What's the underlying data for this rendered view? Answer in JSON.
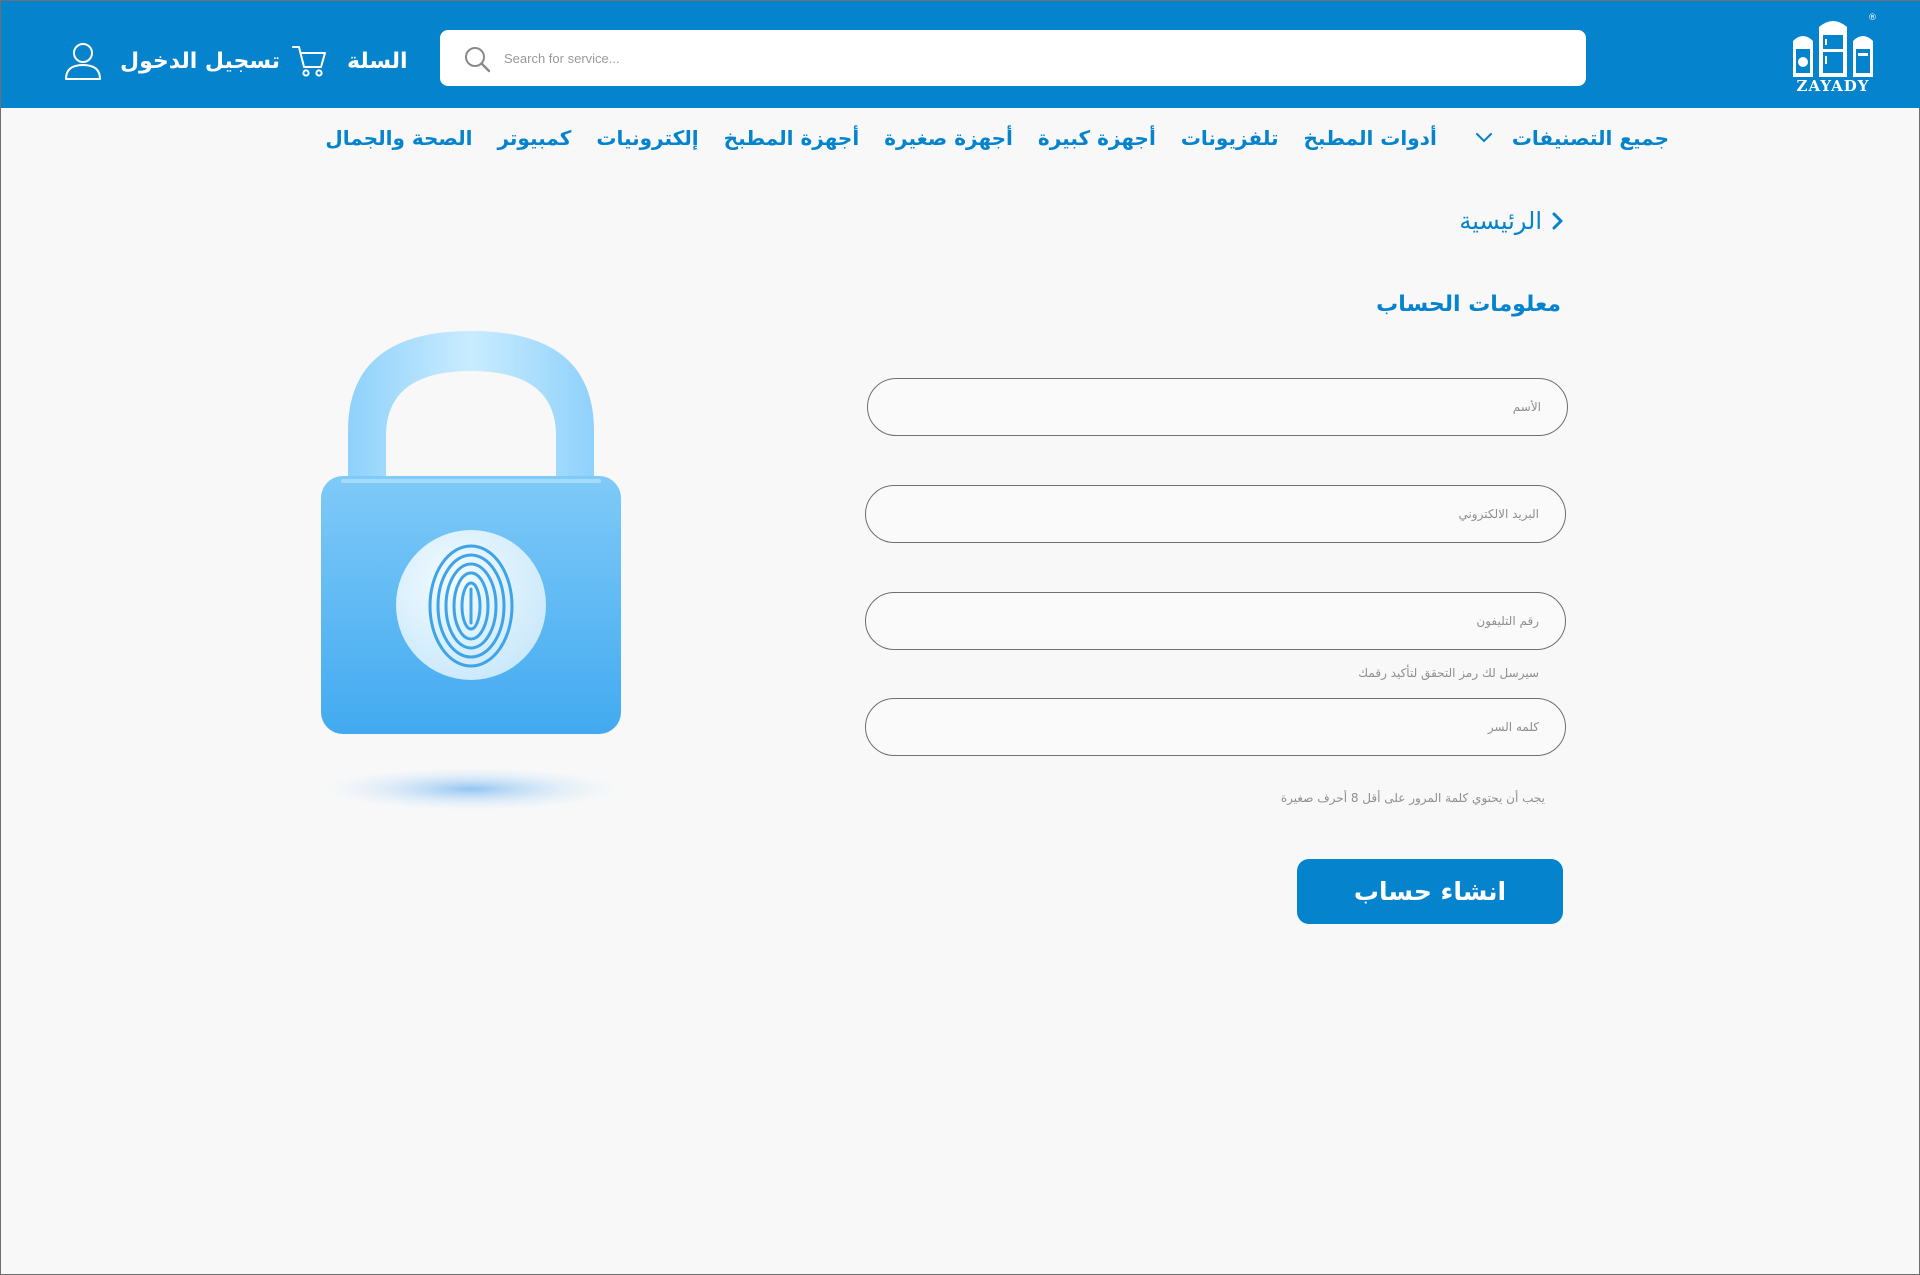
{
  "brand": {
    "name": "ZAYADY",
    "reg_mark": "®"
  },
  "search": {
    "placeholder": "Search for service...",
    "icon": "search-icon"
  },
  "header": {
    "cart_label": "السلة",
    "cart_icon": "cart-icon",
    "login_label": "تسجيل الدخول",
    "login_icon": "user-icon"
  },
  "nav": {
    "items": [
      "جميع التصنيفات",
      "أدوات المطبخ",
      "تلفزيونات",
      "أجهزة كبيرة",
      "أجهزة صغيرة",
      "أجهزة المطبخ",
      "إلكترونيات",
      "كمبيوتر",
      "الصحة والجمال"
    ]
  },
  "breadcrumb": {
    "label": "الرئيسية",
    "icon": "chevron-right-icon"
  },
  "form": {
    "title": "معلومات الحساب",
    "name_placeholder": "الأسم",
    "email_placeholder": "البريد الالكتروني",
    "phone_placeholder": "رقم التليفون",
    "phone_hint": "سيرسل لك رمز التحقق لتأكيد رقمك",
    "password_placeholder": "كلمه السر",
    "password_hint": "يجب أن يحتوي كلمة المرور على أقل 8 أحرف صغيرة",
    "submit_label": "انشاء حساب"
  },
  "colors": {
    "primary": "#0583cc",
    "background": "#f8f8f8",
    "lock": "#5bb8f5"
  }
}
